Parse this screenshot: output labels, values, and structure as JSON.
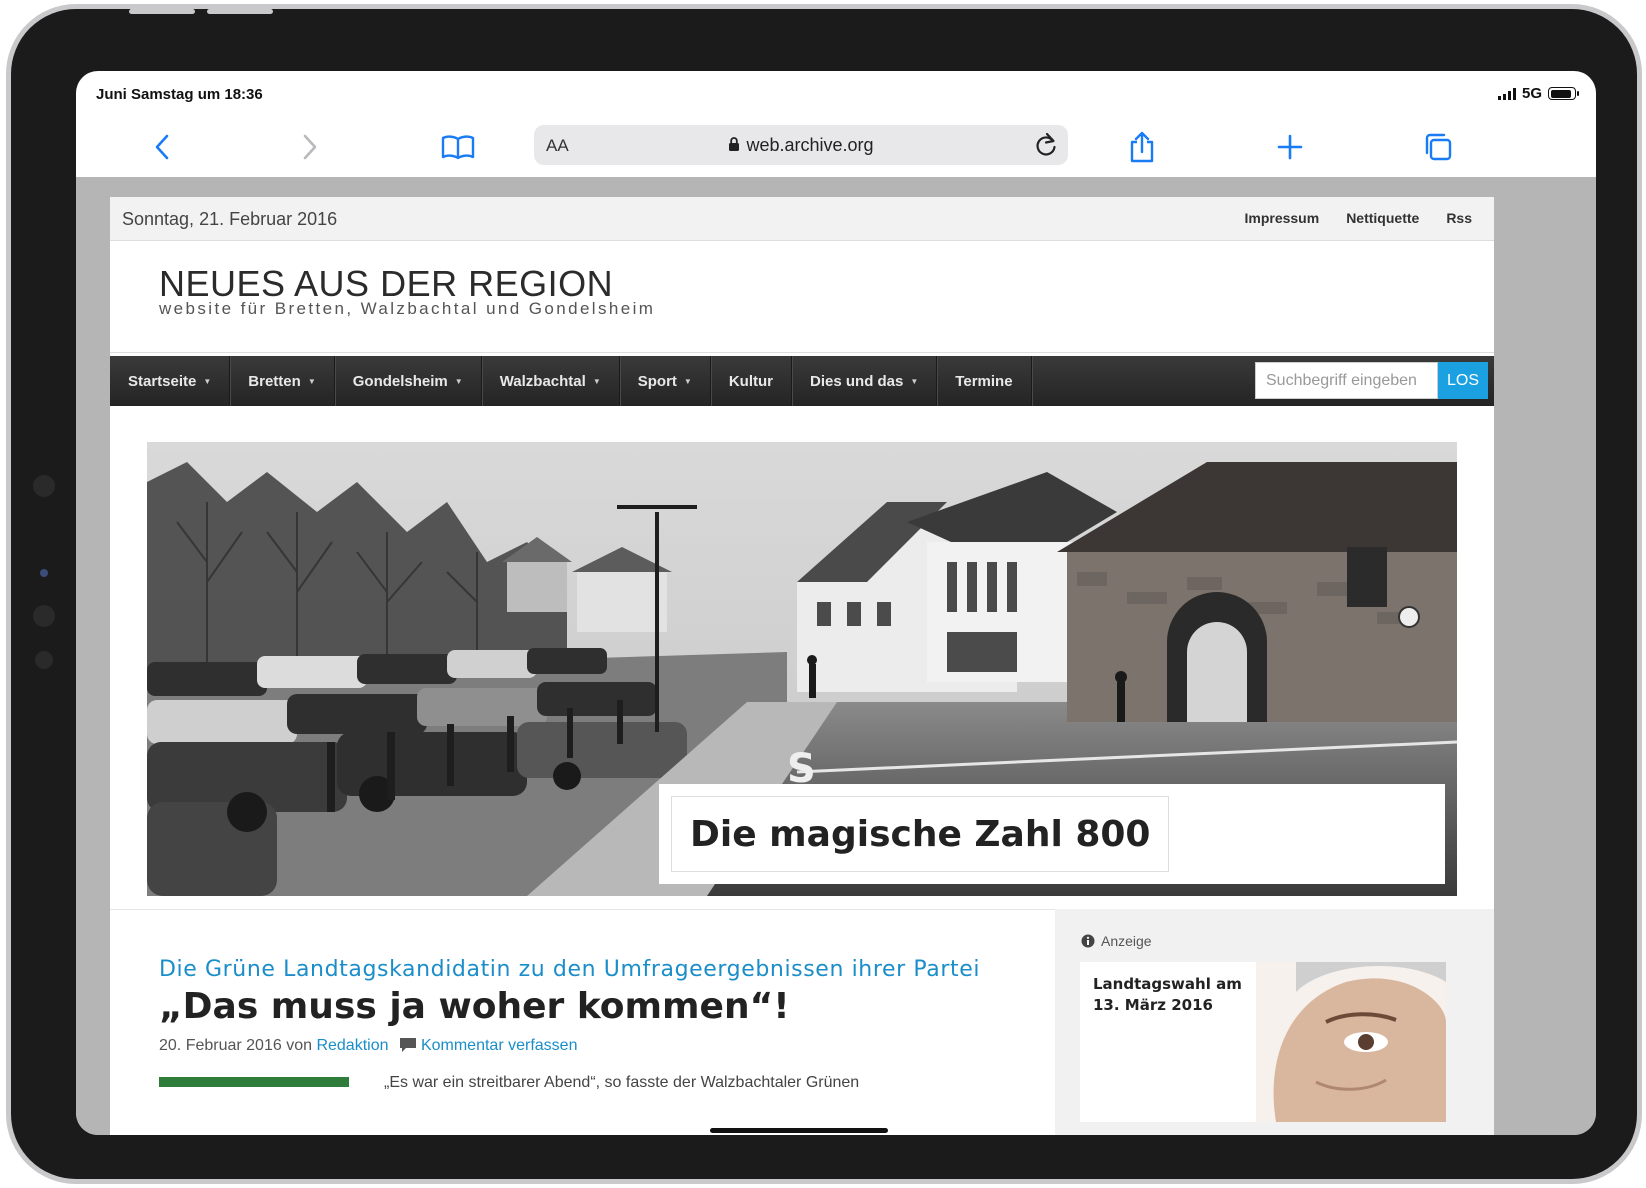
{
  "status": {
    "time": "Juni Samstag um 18:36",
    "network": "5G",
    "battery_level": 0.9
  },
  "browser": {
    "text_size_label": "AA",
    "url": "web.archive.org"
  },
  "topbar": {
    "date": "Sonntag, 21. Februar 2016",
    "links": [
      "Impressum",
      "Nettiquette",
      "Rss"
    ]
  },
  "masthead": {
    "title": "NEUES AUS DER REGION",
    "tagline": "website für Bretten, Walzbachtal und Gondelsheim"
  },
  "nav": {
    "items": [
      {
        "label": "Startseite",
        "dropdown": true
      },
      {
        "label": "Bretten",
        "dropdown": true
      },
      {
        "label": "Gondelsheim",
        "dropdown": true
      },
      {
        "label": "Walzbachtal",
        "dropdown": true
      },
      {
        "label": "Sport",
        "dropdown": true
      },
      {
        "label": "Kultur",
        "dropdown": false
      },
      {
        "label": "Dies und das",
        "dropdown": true
      },
      {
        "label": "Termine",
        "dropdown": false
      }
    ],
    "search_placeholder": "Suchbegriff eingeben",
    "search_button": "LOS"
  },
  "hero": {
    "caption": "Die magische Zahl 800"
  },
  "article": {
    "kicker": "Die Grüne Landtagskandidatin zu den Umfrageergebnissen ihrer Partei",
    "headline": "„Das muss ja woher kommen“!",
    "date": "20. Februar 2016",
    "by": "von",
    "author": "Redaktion",
    "comment_link": "Kommentar verfassen",
    "teaser": "„Es war ein streitbarer Abend“, so fasste der Walzbachtaler Grünen"
  },
  "sidebar": {
    "ad_label": "Anzeige",
    "ad_text_line1": "Landtagswahl am",
    "ad_text_line2": "13. März 2016"
  },
  "colors": {
    "accent": "#1ba1e2",
    "link": "#1b8ec9",
    "nav_bg": "#2e2e2e",
    "ios_blue": "#1a7cf5"
  }
}
